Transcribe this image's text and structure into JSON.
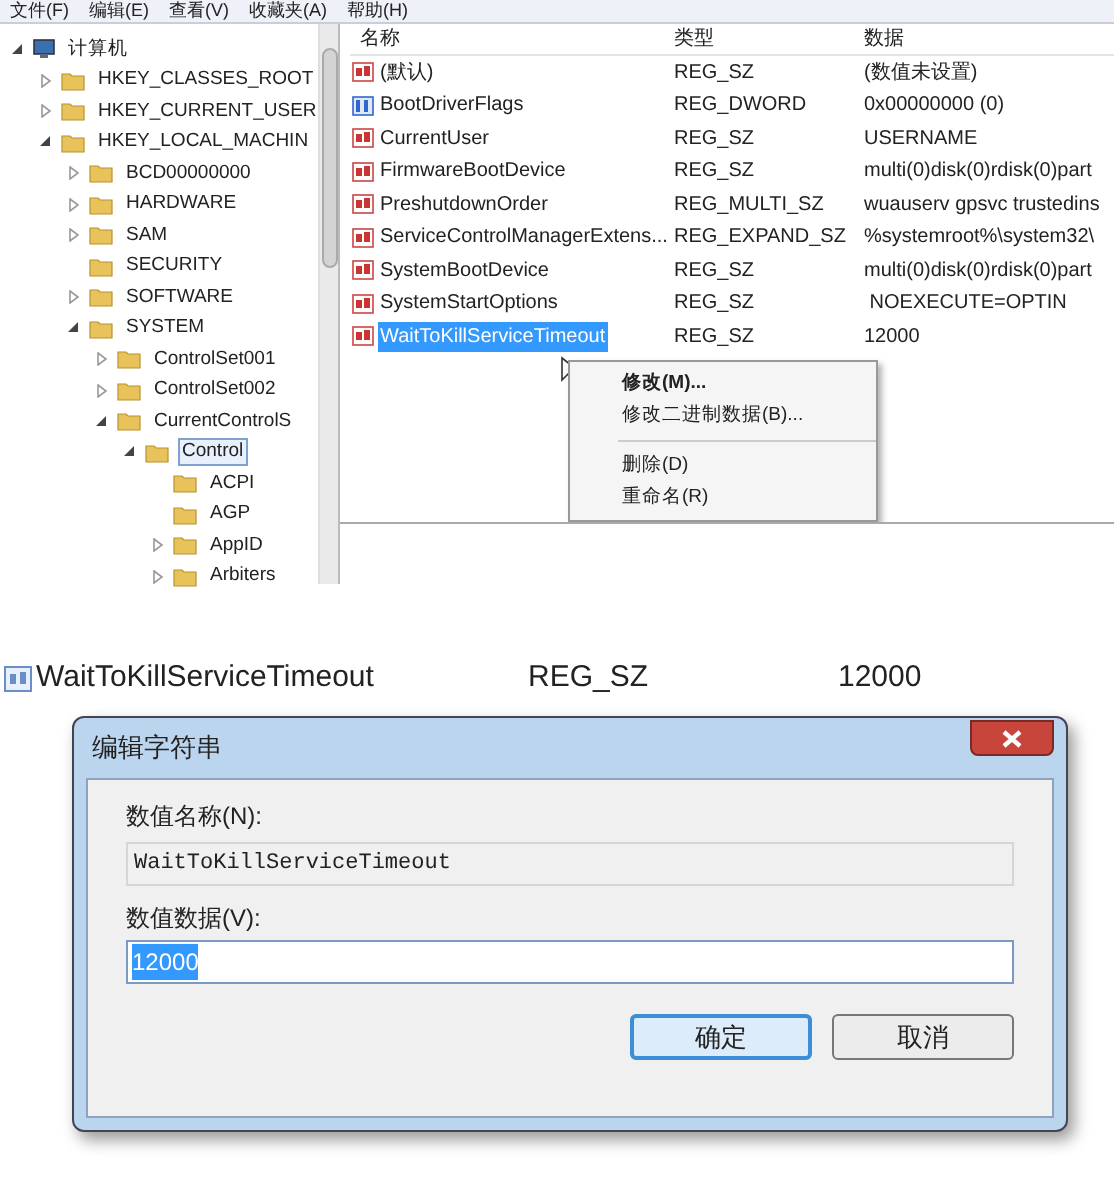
{
  "menu_bar": [
    "文件(F)",
    "编辑(E)",
    "查看(V)",
    "收藏夹(A)",
    "帮助(H)"
  ],
  "tree": [
    {
      "label": "计算机",
      "kind": "computer",
      "expandable": true,
      "expanded": true,
      "selected": false,
      "children": [
        {
          "label": "HKEY_CLASSES_ROOT",
          "kind": "folder",
          "expandable": true,
          "expanded": false,
          "selected": false
        },
        {
          "label": "HKEY_CURRENT_USER",
          "kind": "folder",
          "expandable": true,
          "expanded": false,
          "selected": false
        },
        {
          "label": "HKEY_LOCAL_MACHIN",
          "kind": "folder",
          "expandable": true,
          "expanded": true,
          "selected": false,
          "children": [
            {
              "label": "BCD00000000",
              "kind": "folder",
              "expandable": true,
              "expanded": false,
              "selected": false
            },
            {
              "label": "HARDWARE",
              "kind": "folder",
              "expandable": true,
              "expanded": false,
              "selected": false
            },
            {
              "label": "SAM",
              "kind": "folder",
              "expandable": true,
              "expanded": false,
              "selected": false
            },
            {
              "label": "SECURITY",
              "kind": "folder",
              "expandable": false,
              "selected": false
            },
            {
              "label": "SOFTWARE",
              "kind": "folder",
              "expandable": true,
              "expanded": false,
              "selected": false
            },
            {
              "label": "SYSTEM",
              "kind": "folder",
              "expandable": true,
              "expanded": true,
              "selected": false,
              "children": [
                {
                  "label": "ControlSet001",
                  "kind": "folder",
                  "expandable": true,
                  "expanded": false,
                  "selected": false
                },
                {
                  "label": "ControlSet002",
                  "kind": "folder",
                  "expandable": true,
                  "expanded": false,
                  "selected": false
                },
                {
                  "label": "CurrentControlS",
                  "kind": "folder",
                  "expandable": true,
                  "expanded": true,
                  "selected": false,
                  "children": [
                    {
                      "label": "Control",
                      "kind": "folder",
                      "expandable": true,
                      "expanded": true,
                      "selected": true,
                      "children": [
                        {
                          "label": "ACPI",
                          "kind": "folder",
                          "expandable": false,
                          "selected": false
                        },
                        {
                          "label": "AGP",
                          "kind": "folder",
                          "expandable": false,
                          "selected": false
                        },
                        {
                          "label": "AppID",
                          "kind": "folder",
                          "expandable": true,
                          "expanded": false,
                          "selected": false
                        },
                        {
                          "label": "Arbiters",
                          "kind": "folder",
                          "expandable": true,
                          "expanded": false,
                          "selected": false
                        }
                      ]
                    }
                  ]
                }
              ]
            }
          ]
        }
      ]
    }
  ],
  "columns": [
    "名称",
    "类型",
    "数据"
  ],
  "values": [
    {
      "name": "(默认)",
      "type": "REG_SZ",
      "data": "(数值未设置)",
      "kind": "string",
      "selected": false
    },
    {
      "name": "BootDriverFlags",
      "type": "REG_DWORD",
      "data": "0x00000000 (0)",
      "kind": "binary",
      "selected": false
    },
    {
      "name": "CurrentUser",
      "type": "REG_SZ",
      "data": "USERNAME",
      "kind": "string",
      "selected": false
    },
    {
      "name": "FirmwareBootDevice",
      "type": "REG_SZ",
      "data": "multi(0)disk(0)rdisk(0)part",
      "kind": "string",
      "selected": false
    },
    {
      "name": "PreshutdownOrder",
      "type": "REG_MULTI_SZ",
      "data": "wuauserv gpsvc trustedins",
      "kind": "string",
      "selected": false
    },
    {
      "name": "ServiceControlManagerExtens...",
      "type": "REG_EXPAND_SZ",
      "data": "%systemroot%\\system32\\",
      "kind": "string",
      "selected": false
    },
    {
      "name": "SystemBootDevice",
      "type": "REG_SZ",
      "data": "multi(0)disk(0)rdisk(0)part",
      "kind": "string",
      "selected": false
    },
    {
      "name": "SystemStartOptions",
      "type": "REG_SZ",
      "data": " NOEXECUTE=OPTIN",
      "kind": "string",
      "selected": false
    },
    {
      "name": "WaitToKillServiceTimeout",
      "type": "REG_SZ",
      "data": "12000",
      "kind": "string",
      "selected": true
    }
  ],
  "context_menu": [
    {
      "kind": "item",
      "label": "修改(M)...",
      "default": true
    },
    {
      "kind": "item",
      "label": "修改二进制数据(B)...",
      "default": false
    },
    {
      "kind": "separator"
    },
    {
      "kind": "item",
      "label": "删除(D)",
      "default": false
    },
    {
      "kind": "item",
      "label": "重命名(R)",
      "default": false
    }
  ],
  "zoomed_row": {
    "name": "WaitToKillServiceTimeout",
    "type": "REG_SZ",
    "data": "12000"
  },
  "dialog": {
    "title": "编辑字符串",
    "name_label": "数值名称(N):",
    "name_value": "WaitToKillServiceTimeout",
    "data_label": "数值数据(V):",
    "data_value": "12000",
    "data_selected": true,
    "buttons": [
      {
        "label": "确定",
        "default": true
      },
      {
        "label": "取消",
        "default": false
      }
    ]
  }
}
